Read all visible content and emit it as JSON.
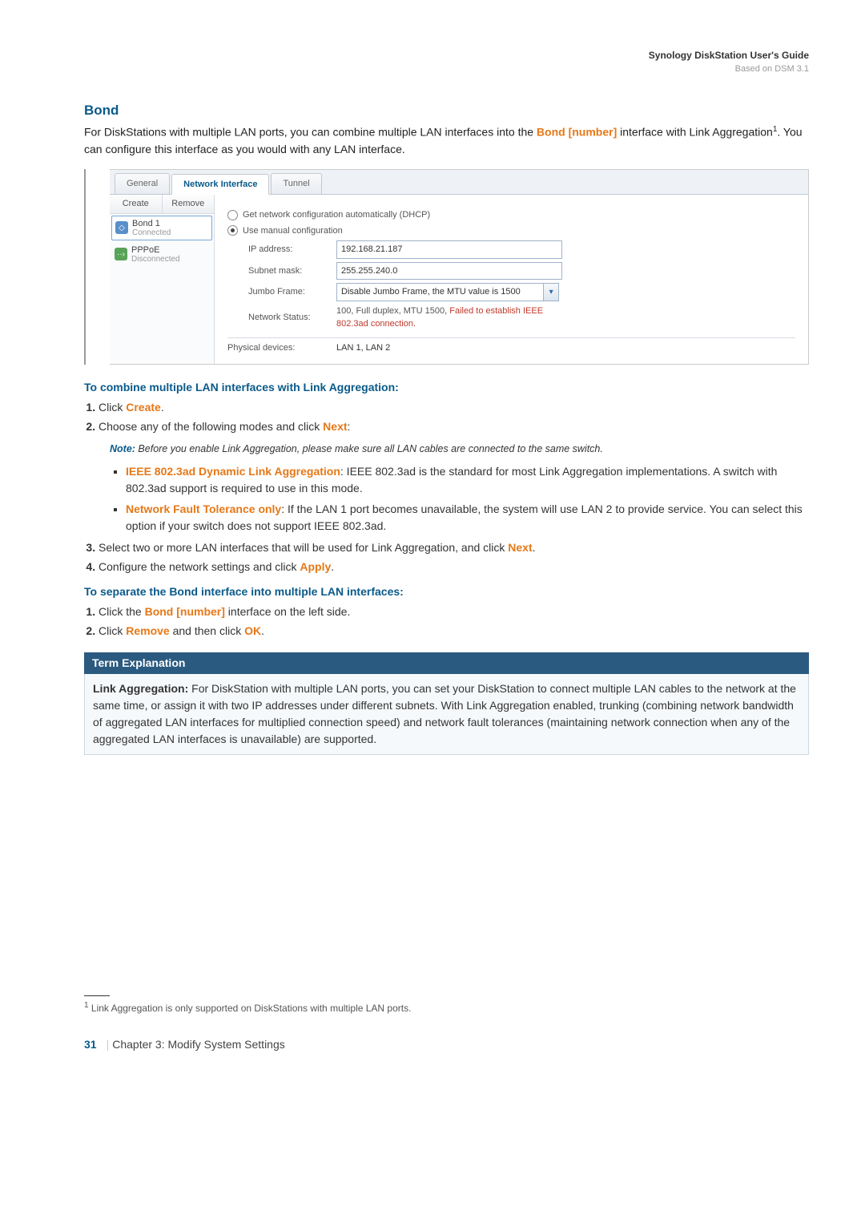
{
  "header": {
    "title": "Synology DiskStation User's Guide",
    "subtitle": "Based on DSM 3.1"
  },
  "section": {
    "title": "Bond",
    "intro_1": "For DiskStations with multiple LAN ports, you can combine multiple LAN interfaces into the ",
    "intro_bold": "Bond [number]",
    "intro_2": " interface with Link Aggregation",
    "intro_sup": "1",
    "intro_3": ". You can configure this interface as you would with any LAN interface."
  },
  "screenshot": {
    "tabs": {
      "general": "General",
      "network_interface": "Network Interface",
      "tunnel": "Tunnel"
    },
    "toolbar": {
      "create": "Create",
      "remove": "Remove"
    },
    "ifaces": {
      "bond": {
        "name": "Bond 1",
        "status": "Connected"
      },
      "pppoe": {
        "name": "PPPoE",
        "status": "Disconnected"
      }
    },
    "radio": {
      "dhcp": "Get network configuration automatically (DHCP)",
      "manual": "Use manual configuration"
    },
    "fields": {
      "ip_label": "IP address:",
      "ip_value": "192.168.21.187",
      "mask_label": "Subnet mask:",
      "mask_value": "255.255.240.0",
      "jumbo_label": "Jumbo Frame:",
      "jumbo_value": "Disable Jumbo Frame, the MTU value is 1500",
      "status_label": "Network Status:",
      "status_value_1": "100, Full duplex, MTU 1500, ",
      "status_value_red": "Failed to establish IEEE 802.3ad connection.",
      "phys_label": "Physical devices:",
      "phys_value": "LAN 1, LAN 2"
    }
  },
  "combine": {
    "heading": "To combine multiple LAN interfaces with Link Aggregation:",
    "step1_a": "Click ",
    "step1_b": "Create",
    "step1_c": ".",
    "step2_a": "Choose any of the following modes and click ",
    "step2_b": "Next",
    "step2_c": ":",
    "note_label": "Note:",
    "note_text": " Before you enable Link Aggregation, please make sure all LAN cables are connected to the same switch.",
    "bullet1_a": "IEEE 802.3ad Dynamic Link Aggregation",
    "bullet1_b": ": IEEE 802.3ad is the standard for most Link Aggregation implementations. A switch with 802.3ad support is required to use in this mode.",
    "bullet2_a": "Network Fault Tolerance only",
    "bullet2_b": ": If the LAN 1 port becomes unavailable, the system will use LAN 2 to provide service. You can select this option if your switch does not support IEEE 802.3ad.",
    "step3_a": "Select two or more LAN interfaces that will be used for Link Aggregation, and click ",
    "step3_b": "Next",
    "step3_c": ".",
    "step4_a": "Configure the network settings and click ",
    "step4_b": "Apply",
    "step4_c": "."
  },
  "separate": {
    "heading": "To separate the Bond interface into multiple LAN interfaces:",
    "step1_a": "Click the ",
    "step1_b": "Bond [number]",
    "step1_c": " interface on the left side.",
    "step2_a": "Click ",
    "step2_b": "Remove",
    "step2_c": " and then click ",
    "step2_d": "OK",
    "step2_e": "."
  },
  "term": {
    "title": "Term Explanation",
    "label": "Link Aggregation:",
    "body": " For DiskStation with multiple LAN ports, you can set your DiskStation to connect multiple LAN cables to the network at the same time, or assign it with two IP addresses under different subnets. With Link Aggregation enabled, trunking (combining network bandwidth of aggregated LAN interfaces for multiplied connection speed) and network fault tolerances (maintaining network connection when any of the aggregated LAN interfaces is unavailable) are supported."
  },
  "footnote": {
    "num": "1",
    "text": " Link Aggregation is only supported on DiskStations with multiple LAN ports."
  },
  "footer": {
    "page": "31",
    "chapter": "Chapter 3: Modify System Settings"
  }
}
